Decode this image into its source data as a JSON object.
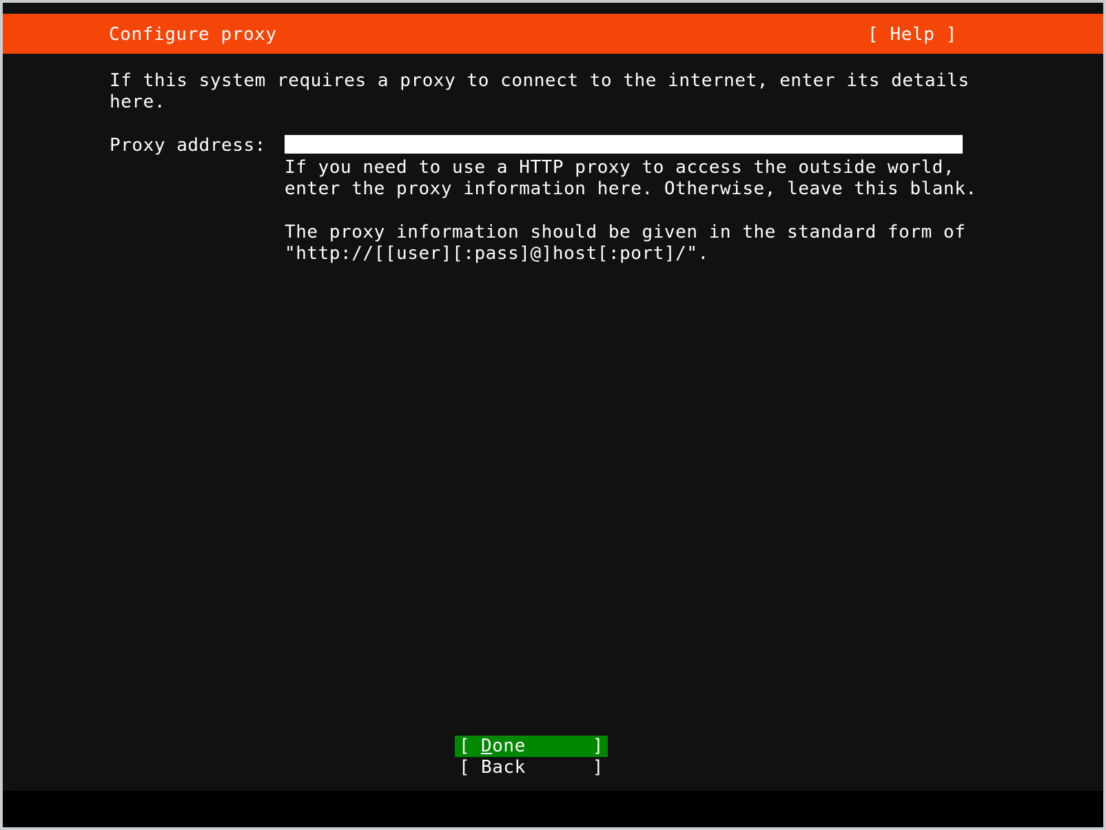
{
  "window": {
    "background_color": "#111111",
    "border_color": "#c9ced1"
  },
  "header": {
    "title": "Configure proxy",
    "help_label": "[ Help ]",
    "background_color": "#f54609",
    "text_color": "#ffffff"
  },
  "main": {
    "intro_line_1": "If this system requires a proxy to connect to the internet, enter its details",
    "intro_line_2": "here.",
    "form": {
      "proxy_label": "Proxy address:",
      "proxy_value": "",
      "proxy_placeholder": ""
    },
    "field_help": {
      "para_1_line_1": "If you need to use a HTTP proxy to access the outside world,",
      "para_1_line_2": "enter the proxy information here. Otherwise, leave this blank.",
      "para_2_line_1": "The proxy information should be given in the standard form of",
      "para_2_line_2": "\"http://[[user][:pass]@]host[:port]/\"."
    }
  },
  "buttons": {
    "done": {
      "bracket_left": "[",
      "bracket_right": "]",
      "accel": "D",
      "rest": "one",
      "selected": true,
      "selected_background": "#008700"
    },
    "back": {
      "bracket_left": "[",
      "bracket_right": "]",
      "accel": "",
      "rest": "Back",
      "selected": false
    }
  }
}
